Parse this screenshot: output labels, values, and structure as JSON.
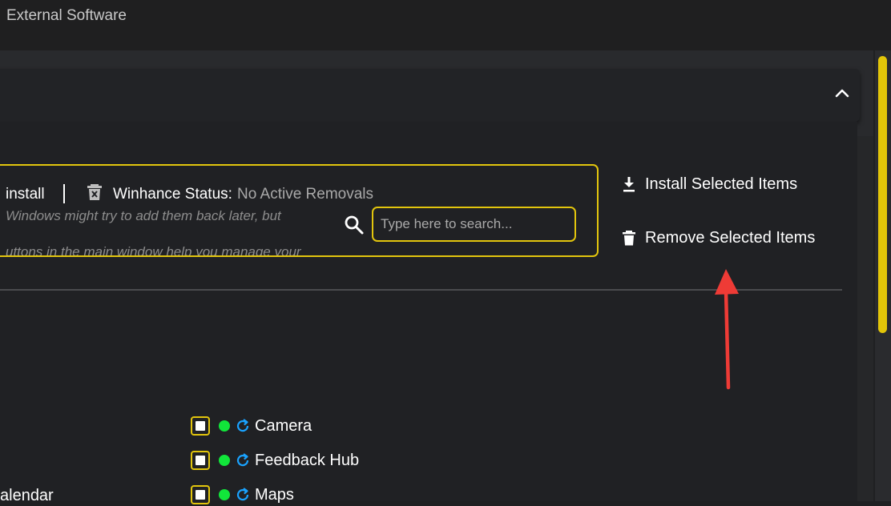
{
  "window": {
    "title": "External Software"
  },
  "status_panel": {
    "install_label": "install",
    "status_label": "Winhance Status:",
    "status_value": "No Active Removals",
    "desc_line1": "Windows might try to add them back later, but",
    "desc_line2": "uttons in the main window help you manage your"
  },
  "search": {
    "placeholder": "Type here to search...",
    "value": ""
  },
  "actions": {
    "install_label": "Install Selected Items",
    "remove_label": "Remove Selected Items"
  },
  "apps_column2": [
    {
      "label": "Camera"
    },
    {
      "label": "Feedback Hub"
    },
    {
      "label": "Maps"
    }
  ],
  "apps_column1": [
    {
      "label": "alendar"
    }
  ],
  "colors": {
    "accent": "#e2c50d",
    "status_dot": "#11e63a",
    "sync_icon": "#1aa3ff",
    "annotation_arrow": "#ee3b36"
  },
  "icons": {
    "collapse": "chevron-up-icon",
    "status": "trash-x-icon",
    "search": "search-icon",
    "install": "download-icon",
    "remove": "trash-icon",
    "sync": "sync-icon"
  }
}
